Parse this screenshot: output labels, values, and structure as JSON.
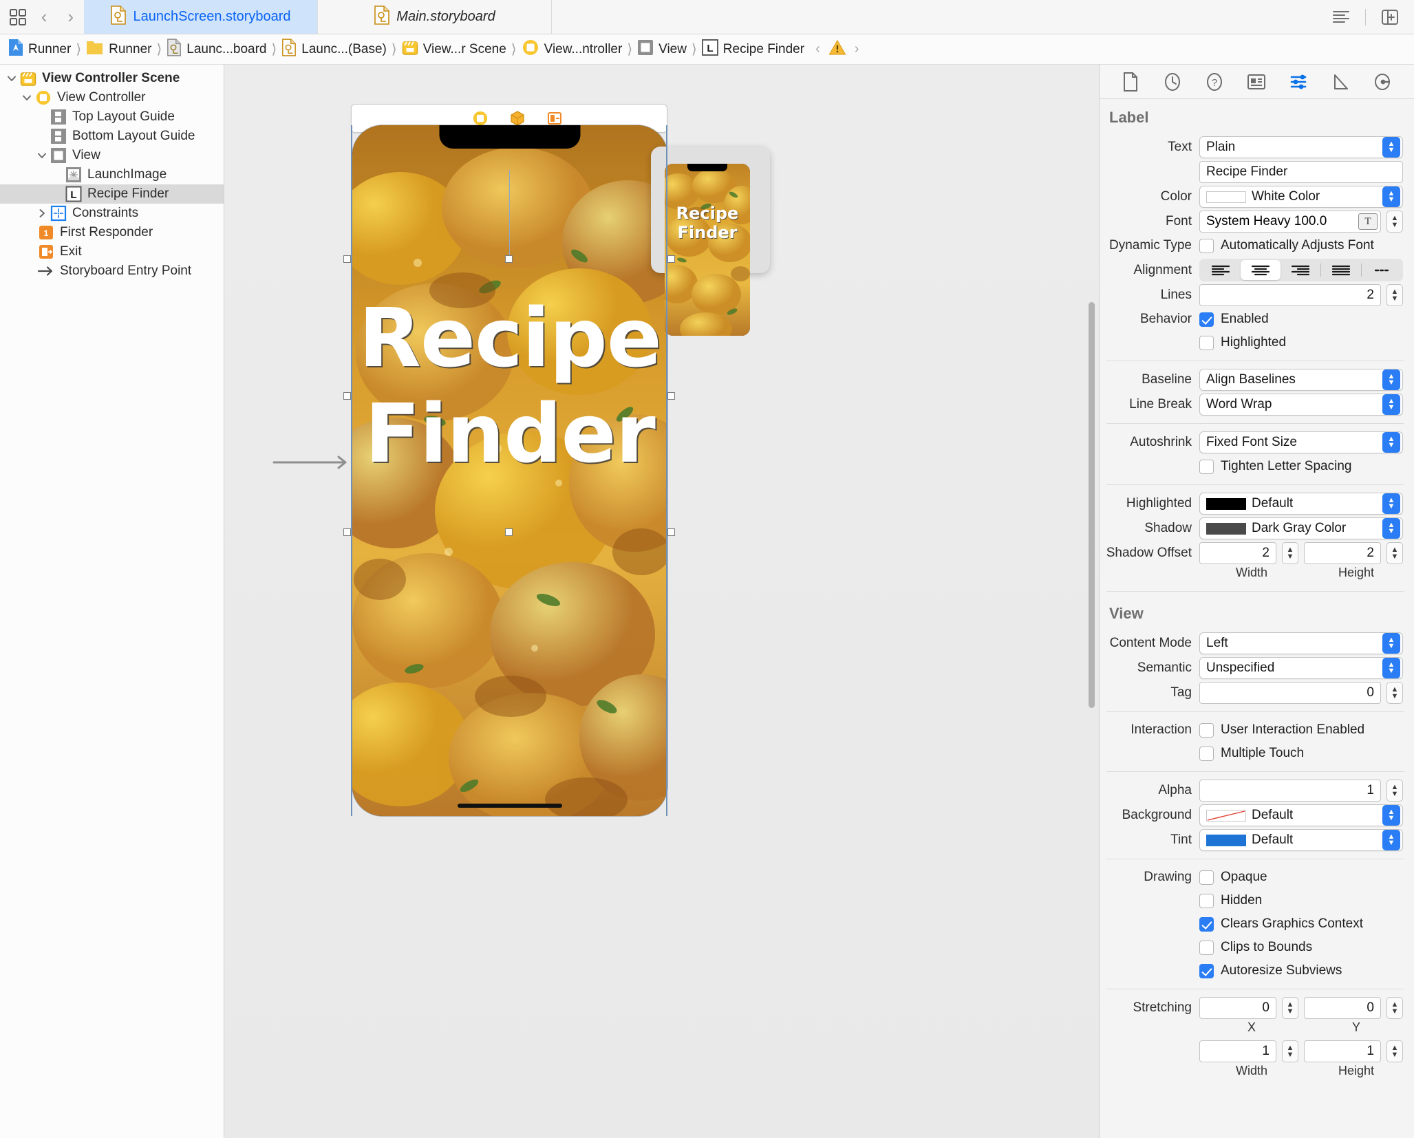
{
  "tabbar": {
    "tabs": [
      {
        "label": "LaunchScreen.storyboard",
        "icon": "storyboard-icon",
        "active": true
      },
      {
        "label": "Main.storyboard",
        "icon": "storyboard-icon",
        "active": false
      }
    ],
    "right_icons": [
      "lines-icon",
      "panel-toggle-icon"
    ],
    "left_icons": [
      "grid-icon",
      "back-arrow-icon",
      "forward-arrow-icon"
    ]
  },
  "breadcrumb": {
    "items": [
      {
        "label": "Runner",
        "icon": "xcode-project-icon"
      },
      {
        "label": "Runner",
        "icon": "folder-icon"
      },
      {
        "label": "Launc...board",
        "icon": "storyboard-gray-icon"
      },
      {
        "label": "Launc...(Base)",
        "icon": "storyboard-icon"
      },
      {
        "label": "View...r Scene",
        "icon": "scene-icon"
      },
      {
        "label": "View...ntroller",
        "icon": "view-controller-icon"
      },
      {
        "label": "View",
        "icon": "view-icon"
      },
      {
        "label": "Recipe Finder",
        "icon": "label-icon"
      }
    ],
    "tools": {
      "prev": "‹",
      "warning": "warning-icon",
      "next": "›"
    }
  },
  "outline": {
    "rows": [
      {
        "label": "View Controller Scene",
        "indent": 0,
        "disc": "down",
        "icon": "scene-icon",
        "bold": true,
        "selected": false
      },
      {
        "label": "View Controller",
        "indent": 1,
        "disc": "down",
        "icon": "view-controller-icon",
        "bold": false,
        "selected": false
      },
      {
        "label": "Top Layout Guide",
        "indent": 2,
        "disc": "none",
        "icon": "layout-guide-icon",
        "bold": false,
        "selected": false
      },
      {
        "label": "Bottom Layout Guide",
        "indent": 2,
        "disc": "none",
        "icon": "layout-guide-icon",
        "bold": false,
        "selected": false
      },
      {
        "label": "View",
        "indent": 2,
        "disc": "down",
        "icon": "view-icon",
        "bold": false,
        "selected": false
      },
      {
        "label": "LaunchImage",
        "indent": 3,
        "disc": "none",
        "icon": "image-view-icon",
        "bold": false,
        "selected": false
      },
      {
        "label": "Recipe Finder",
        "indent": 3,
        "disc": "none",
        "icon": "label-icon",
        "bold": false,
        "selected": true
      },
      {
        "label": "Constraints",
        "indent": 3,
        "disc": "right",
        "icon": "constraints-icon",
        "bold": false,
        "selected": false
      },
      {
        "label": "First Responder",
        "indent": 0,
        "disc": "none",
        "icon": "first-responder-icon",
        "bold": false,
        "selected": false
      },
      {
        "label": "Exit",
        "indent": 0,
        "disc": "none",
        "icon": "exit-icon",
        "bold": false,
        "selected": false
      },
      {
        "label": "Storyboard Entry Point",
        "indent": 0,
        "disc": "none",
        "icon": "entry-point-arrow-icon",
        "bold": false,
        "selected": false
      }
    ]
  },
  "canvas": {
    "device_toolbar_icons": [
      "view-controller-icon",
      "cube-icon",
      "first-responder-small-icon"
    ],
    "preview_title": "Recipe\nFinder",
    "preview_title_line1": "Recipe",
    "preview_title_line2": "Finder",
    "mini_title_line1": "Recipe",
    "mini_title_line2": "Finder"
  },
  "inspector": {
    "tabs": [
      {
        "icon": "file-inspector-icon",
        "active": false
      },
      {
        "icon": "history-inspector-icon",
        "active": false
      },
      {
        "icon": "quick-help-icon",
        "active": false
      },
      {
        "icon": "identity-inspector-icon",
        "active": false
      },
      {
        "icon": "attributes-inspector-icon",
        "active": true
      },
      {
        "icon": "size-inspector-icon",
        "active": false
      },
      {
        "icon": "connections-inspector-icon",
        "active": false
      }
    ],
    "label_section": {
      "title": "Label",
      "text_label": "Text",
      "text_value": "Plain",
      "text_content": "Recipe Finder",
      "color_label": "Color",
      "color_value": "White Color",
      "color_swatch": "#ffffff",
      "font_label": "Font",
      "font_value": "System Heavy 100.0",
      "dynamic_type_label": "Dynamic Type",
      "dynamic_type_checkbox": "Automatically Adjusts Font",
      "dynamic_type_checked": false,
      "alignment_label": "Alignment",
      "alignment_selected_index": 1,
      "alignment_options": [
        "left",
        "center",
        "right",
        "justified",
        "natural"
      ],
      "lines_label": "Lines",
      "lines_value": "2",
      "behavior_label": "Behavior",
      "behavior_enabled_label": "Enabled",
      "behavior_enabled_checked": true,
      "behavior_highlighted_label": "Highlighted",
      "behavior_highlighted_checked": false,
      "baseline_label": "Baseline",
      "baseline_value": "Align Baselines",
      "line_break_label": "Line Break",
      "line_break_value": "Word Wrap",
      "autoshrink_label": "Autoshrink",
      "autoshrink_value": "Fixed Font Size",
      "tighten_label": "Tighten Letter Spacing",
      "tighten_checked": false,
      "highlighted_label": "Highlighted",
      "highlighted_value": "Default",
      "highlighted_swatch": "#000000",
      "shadow_label": "Shadow",
      "shadow_value": "Dark Gray Color",
      "shadow_swatch": "#4a4a4a",
      "shadow_offset_label": "Shadow Offset",
      "shadow_offset_width": "2",
      "shadow_offset_height": "2",
      "width_caption": "Width",
      "height_caption": "Height"
    },
    "view_section": {
      "title": "View",
      "content_mode_label": "Content Mode",
      "content_mode_value": "Left",
      "semantic_label": "Semantic",
      "semantic_value": "Unspecified",
      "tag_label": "Tag",
      "tag_value": "0",
      "interaction_label": "Interaction",
      "user_interaction_label": "User Interaction Enabled",
      "user_interaction_checked": false,
      "multiple_touch_label": "Multiple Touch",
      "multiple_touch_checked": false,
      "alpha_label": "Alpha",
      "alpha_value": "1",
      "background_label": "Background",
      "background_value": "Default",
      "tint_label": "Tint",
      "tint_value": "Default",
      "tint_swatch": "#1e74d4",
      "drawing_label": "Drawing",
      "opaque_label": "Opaque",
      "opaque_checked": false,
      "hidden_label": "Hidden",
      "hidden_checked": false,
      "clears_label": "Clears Graphics Context",
      "clears_checked": true,
      "clips_label": "Clips to Bounds",
      "clips_checked": false,
      "autoresize_label": "Autoresize Subviews",
      "autoresize_checked": true,
      "stretching_label": "Stretching",
      "stretching_x": "0",
      "stretching_y": "0",
      "stretching_width": "1",
      "stretching_height": "1",
      "x_caption": "X",
      "y_caption": "Y",
      "width_caption": "Width",
      "height_caption": "Height"
    }
  },
  "colors": {
    "accent_blue": "#2a7df4",
    "tab_active_bg": "#cfe4fb",
    "tab_active_text": "#0a63f3",
    "selection_gray": "#d9d9d9"
  }
}
